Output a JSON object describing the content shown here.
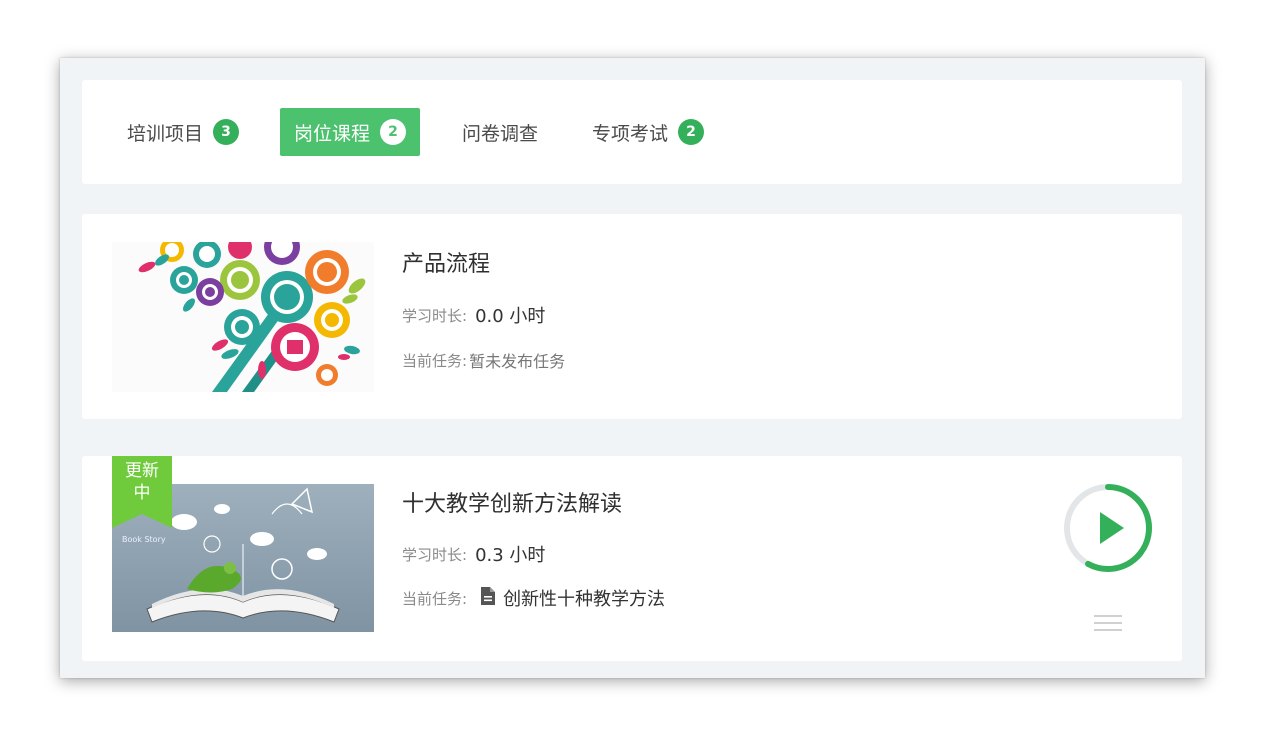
{
  "tabs": [
    {
      "label": "培训项目",
      "count": "3",
      "active": false
    },
    {
      "label": "岗位课程",
      "count": "2",
      "active": true
    },
    {
      "label": "问卷调查",
      "count": "",
      "active": false
    },
    {
      "label": "专项考试",
      "count": "2",
      "active": false
    }
  ],
  "courses": [
    {
      "title": "产品流程",
      "duration_label": "学习时长:",
      "duration_value": "0.0 小时",
      "task_label": "当前任务:",
      "task_value": "暂未发布任务",
      "thumbnail_icon": "colorful-gears-illustration"
    },
    {
      "title": "十大教学创新方法解读",
      "duration_label": "学习时长:",
      "duration_value": "0.3 小时",
      "task_label": "当前任务:",
      "task_value": "创新性十种教学方法",
      "ribbon_line1": "更新",
      "ribbon_line2": "中",
      "thumbnail_icon": "open-book-illustration",
      "thumbnail_caption": "Book Story",
      "progress": 0.58
    }
  ],
  "colors": {
    "accent": "#4cc26f",
    "badge": "#35b05a",
    "background": "#f0f4f7"
  }
}
